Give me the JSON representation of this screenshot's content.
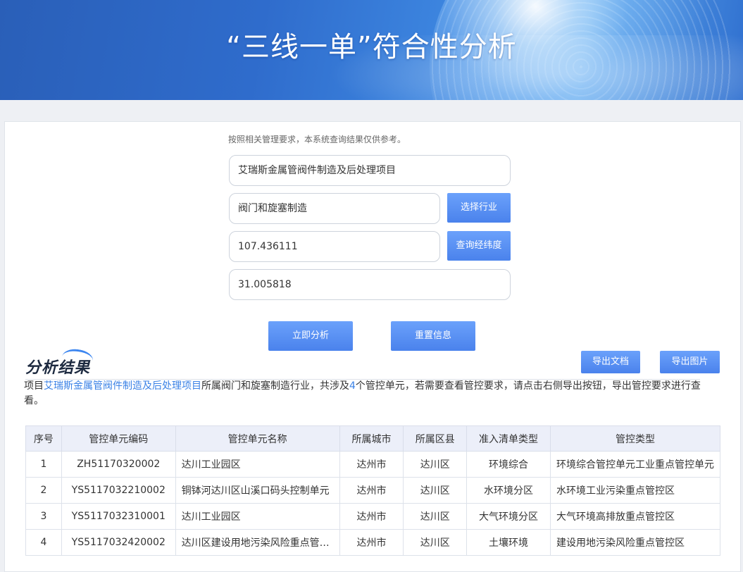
{
  "banner": {
    "title": "“三线一单”符合性分析"
  },
  "form": {
    "hint": "按照相关管理要求，本系统查询结果仅供参考。",
    "project_name": "艾瑞斯金属管阀件制造及后处理项目",
    "industry": "阀门和旋塞制造",
    "select_industry_label": "选择行业",
    "longitude": "107.436111",
    "query_coords_label": "查询经纬度",
    "latitude": "31.005818",
    "analyze_label": "立即分析",
    "reset_label": "重置信息"
  },
  "result": {
    "logo_text": "分析结果",
    "export_doc_label": "导出文档",
    "export_img_label": "导出图片",
    "summary": {
      "p1": "项目",
      "project": "艾瑞斯金属管阀件制造及后处理项目",
      "p2": "所属阀门和旋塞制造行业，共涉及",
      "count": "4",
      "p3": "个管控单元，若需要查看管控要求，请点击右侧导出按钮，导出管控要求进行查看。"
    },
    "table": {
      "headers": [
        "序号",
        "管控单元编码",
        "管控单元名称",
        "所属城市",
        "所属区县",
        "准入清单类型",
        "管控类型"
      ],
      "rows": [
        [
          "1",
          "ZH51170320002",
          "达川工业园区",
          "达州市",
          "达川区",
          "环境综合",
          "环境综合管控单元工业重点管控单元"
        ],
        [
          "2",
          "YS5117032210002",
          "铜钵河达川区山溪口码头控制单元",
          "达州市",
          "达川区",
          "水环境分区",
          "水环境工业污染重点管控区"
        ],
        [
          "3",
          "YS5117032310001",
          "达川工业园区",
          "达州市",
          "达川区",
          "大气环境分区",
          "大气环境高排放重点管控区"
        ],
        [
          "4",
          "YS5117032420002",
          "达川区建设用地污染风险重点管…",
          "达州市",
          "达川区",
          "土壤环境",
          "建设用地污染风险重点管控区"
        ]
      ]
    }
  }
}
